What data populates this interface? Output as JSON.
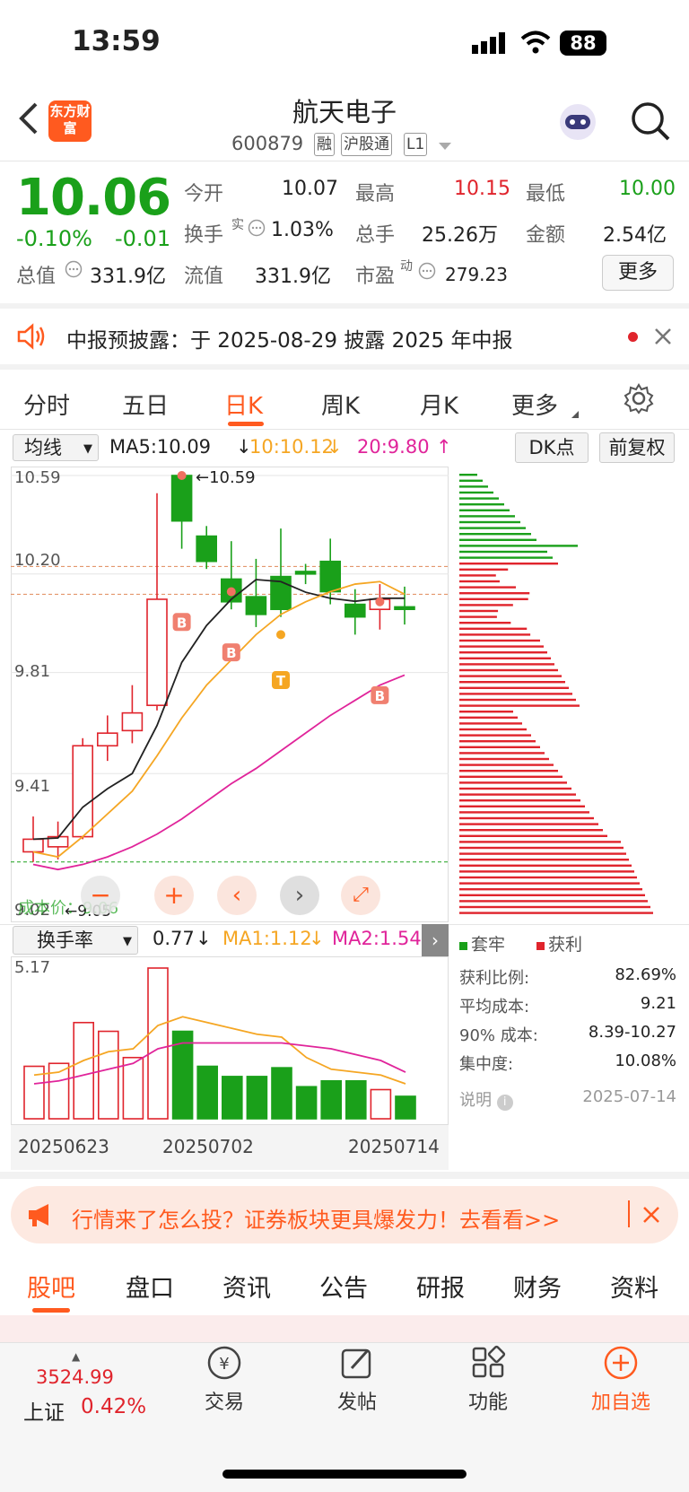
{
  "status": {
    "time": "13:59",
    "battery": "88"
  },
  "header": {
    "logo": "东方财富",
    "name": "航天电子",
    "code": "600879",
    "tags": [
      "融",
      "沪股通",
      "L1"
    ]
  },
  "quote": {
    "price": "10.06",
    "pct": "-0.10%",
    "change": "-0.01",
    "open_label": "今开",
    "open": "10.07",
    "high_label": "最高",
    "high": "10.15",
    "low_label": "最低",
    "low": "10.00",
    "turnover_label": "换手",
    "turnover_sup": "实",
    "turnover": "1.03%",
    "vol_label": "总手",
    "vol": "25.26万",
    "amt_label": "金额",
    "amt": "2.54亿",
    "mcap_label": "总值",
    "mcap": "331.9亿",
    "float_label": "流值",
    "float": "331.9亿",
    "pe_label": "市盈",
    "pe_sup": "动",
    "pe": "279.23",
    "more": "更多"
  },
  "notice": {
    "text": "中报预披露：于 2025-08-29 披露 2025 年中报"
  },
  "tabs": [
    "分时",
    "五日",
    "日K",
    "周K",
    "月K",
    "更多"
  ],
  "ma_bar": {
    "select": "均线",
    "ma5": "MA5:10.09",
    "ma10": "10:10.12",
    "ma20": "20:9.80",
    "dk": "DK点",
    "adj": "前复权"
  },
  "price_axis": [
    "10.59",
    "10.20",
    "9.81",
    "9.41",
    "9.02"
  ],
  "annotations": {
    "high": "10.59",
    "low": "9.05",
    "cost": "成本价：9.06"
  },
  "vol_bar": {
    "select": "换手率",
    "val": "0.77",
    "ma1": "MA1:1.12",
    "ma2": "MA2:1.54"
  },
  "vol_axis": "5.17",
  "dates": [
    "20250623",
    "20250702",
    "20250714"
  ],
  "chips": {
    "legend_trap": "套牢",
    "legend_profit": "获利",
    "rows": [
      [
        "获利比例:",
        "82.69%"
      ],
      [
        "平均成本:",
        "9.21"
      ],
      [
        "90% 成本:",
        "8.39-10.27"
      ],
      [
        "集中度:",
        "10.08%"
      ]
    ],
    "note": "说明",
    "date": "2025-07-14"
  },
  "promo": {
    "text": "行情来了怎么投？证券板块更具爆发力！去看看>>"
  },
  "bottom_tabs": [
    "股吧",
    "盘口",
    "资讯",
    "公告",
    "研报",
    "财务",
    "资料"
  ],
  "bottom_bar": {
    "index_value": "3524.99",
    "index_name": "上证",
    "index_pct": "0.42%",
    "items": [
      "交易",
      "发帖",
      "功能",
      "加自选"
    ]
  },
  "colors": {
    "up": "#e0242c",
    "down": "#1aa01a",
    "accent": "#ff5a1f",
    "ma5": "#222222",
    "ma10": "#f5a623",
    "ma20": "#e0249a"
  },
  "chart_data": {
    "type": "candlestick",
    "ylim": [
      9.02,
      10.59
    ],
    "candles": [
      [
        9.1,
        9.15,
        9.06,
        9.24
      ],
      [
        9.12,
        9.16,
        9.07,
        9.22
      ],
      [
        9.16,
        9.52,
        9.15,
        9.55
      ],
      [
        9.52,
        9.57,
        9.46,
        9.64
      ],
      [
        9.58,
        9.65,
        9.53,
        9.76
      ],
      [
        9.68,
        10.1,
        9.66,
        10.52
      ],
      [
        10.59,
        10.41,
        10.3,
        10.59
      ],
      [
        10.35,
        10.25,
        10.22,
        10.39
      ],
      [
        10.18,
        10.09,
        10.06,
        10.33
      ],
      [
        10.11,
        10.04,
        9.99,
        10.26
      ],
      [
        10.19,
        10.06,
        10.03,
        10.38
      ],
      [
        10.21,
        10.2,
        10.16,
        10.24
      ],
      [
        10.25,
        10.13,
        10.08,
        10.34
      ],
      [
        10.08,
        10.03,
        9.96,
        10.14
      ],
      [
        10.06,
        10.1,
        9.98,
        10.16
      ],
      [
        10.07,
        10.06,
        10.0,
        10.15
      ]
    ],
    "vol": [
      1.8,
      1.9,
      3.3,
      3.0,
      2.1,
      5.17,
      3.0,
      1.8,
      1.45,
      1.45,
      1.75,
      1.1,
      1.3,
      1.3,
      1.0,
      0.77
    ]
  }
}
